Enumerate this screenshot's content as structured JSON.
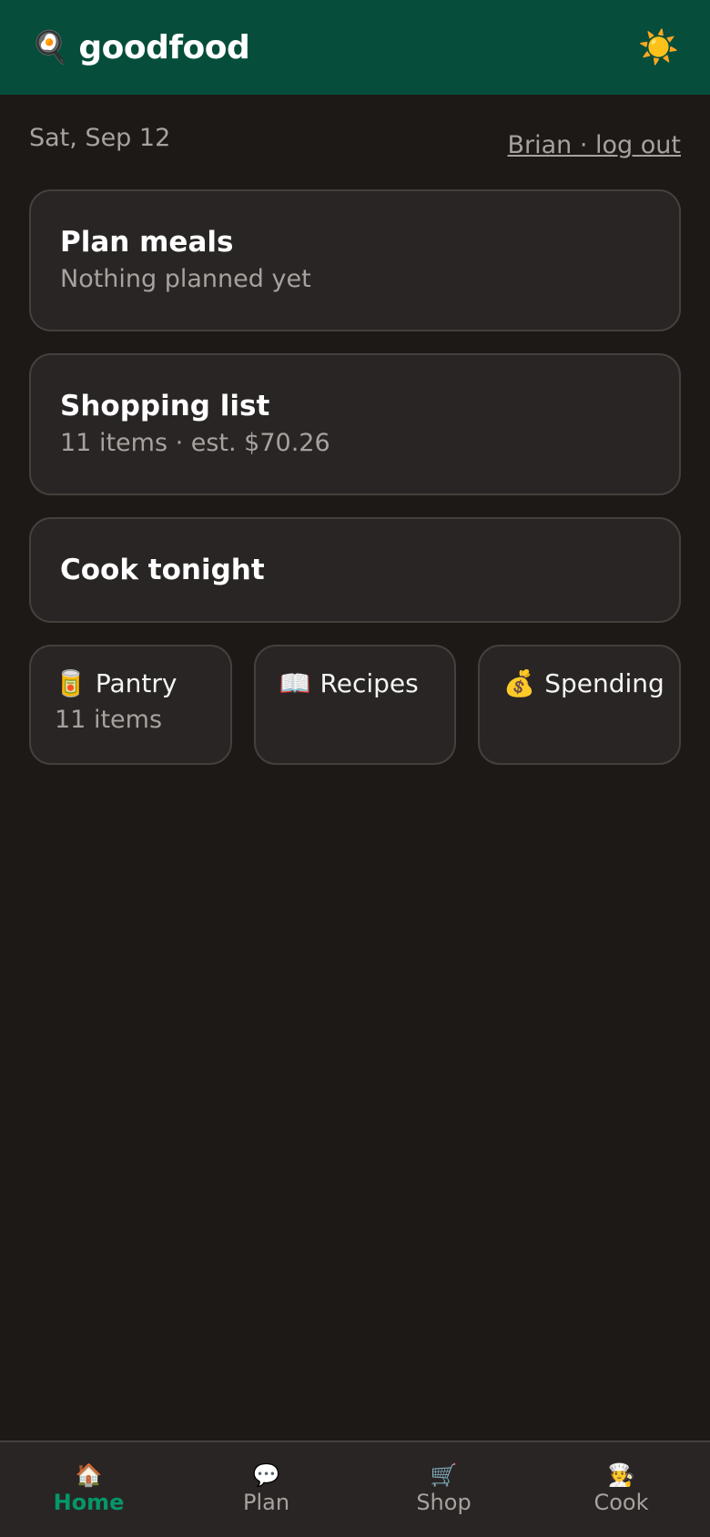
{
  "header": {
    "brand_icon": "🍳",
    "brand_name": "goodfood",
    "theme_toggle_icon": "☀️"
  },
  "meta": {
    "date": "Sat, Sep 12",
    "user_link": "Brian · log out"
  },
  "cards": {
    "plan": {
      "title": "Plan meals",
      "subtitle": "Nothing planned yet"
    },
    "shopping": {
      "title": "Shopping list",
      "subtitle": "11 items · est. $70.26"
    },
    "cook": {
      "title": "Cook tonight"
    }
  },
  "tiles": {
    "pantry": {
      "icon": "🥫",
      "label": "Pantry",
      "subtitle": "11 items"
    },
    "recipes": {
      "icon": "📖",
      "label": "Recipes"
    },
    "spending": {
      "icon": "💰",
      "label": "Spending"
    }
  },
  "nav": {
    "items": [
      {
        "icon": "🏠",
        "label": "Home",
        "active": true
      },
      {
        "icon": "💬",
        "label": "Plan"
      },
      {
        "icon": "🛒",
        "label": "Shop"
      },
      {
        "icon": "🧑‍🍳",
        "label": "Cook"
      }
    ]
  },
  "colors": {
    "header_bg": "#064e3b",
    "page_bg": "#1c1917",
    "card_bg": "#292524",
    "accent": "#059669"
  }
}
